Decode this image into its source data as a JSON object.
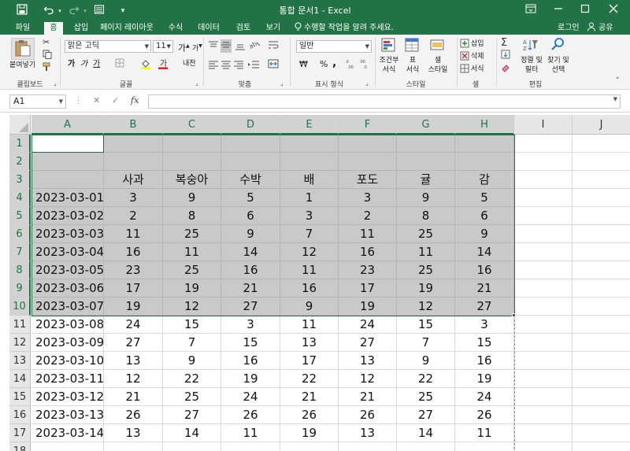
{
  "titlebar": {
    "title": "통합 문서1 - Excel",
    "save_icon": "save-icon",
    "undo_icon": "undo-icon",
    "redo_icon": "redo-icon",
    "form_icon": "form-icon",
    "customize_icon": "customize-icon",
    "ribbon_display_icon": "ribbon-display-icon",
    "minimize_icon": "minimize-icon",
    "restore_icon": "restore-icon",
    "close_icon": "close-icon"
  },
  "tabs": {
    "items": [
      "파일",
      "홈",
      "삽입",
      "페이지 레이아웃",
      "수식",
      "데이터",
      "검토",
      "보기"
    ],
    "active": "홈",
    "tell_me": "수행할 작업을 알려 주세요.",
    "login": "로그인",
    "share": "공유"
  },
  "ribbon": {
    "clipboard": {
      "paste": "붙여넣기",
      "label": "클립보드"
    },
    "font": {
      "name": "맑은 고딕",
      "size": "11",
      "bold": "가",
      "italic": "가",
      "underline": "가",
      "grow": "가",
      "shrink": "가",
      "phonetic": "내천",
      "label": "글꼴"
    },
    "align": {
      "label": "맞춤"
    },
    "number": {
      "format": "일반",
      "currency": "₩",
      "percent": "%",
      "comma": ",",
      "label": "표시 형식"
    },
    "styles": {
      "conditional": "조건부\n서식",
      "table": "표\n서식",
      "cell_style": "셀\n스타일",
      "label": "스타일"
    },
    "cells": {
      "insert": "삽입",
      "delete": "삭제",
      "format": "서식",
      "label": "셀"
    },
    "editing": {
      "sort": "정렬 및\n필터",
      "find": "찾기 및\n선택",
      "label": "편집"
    }
  },
  "formula_bar": {
    "namebox": "A1",
    "cancel": "✕",
    "enter": "✓",
    "fx": "fx",
    "value": ""
  },
  "sheet": {
    "columns": [
      "A",
      "B",
      "C",
      "D",
      "E",
      "F",
      "G",
      "H",
      "I",
      "J"
    ],
    "rows": [
      "1",
      "2",
      "3",
      "4",
      "5",
      "6",
      "7",
      "8",
      "9",
      "10",
      "11",
      "12",
      "13",
      "14",
      "15",
      "16",
      "17",
      "18"
    ],
    "headers": [
      "",
      "사과",
      "복숭아",
      "수박",
      "배",
      "포도",
      "귤",
      "감"
    ],
    "data": [
      [
        "2023-03-01",
        "3",
        "9",
        "5",
        "1",
        "3",
        "9",
        "5"
      ],
      [
        "2023-03-02",
        "2",
        "8",
        "6",
        "3",
        "2",
        "8",
        "6"
      ],
      [
        "2023-03-03",
        "11",
        "25",
        "9",
        "7",
        "11",
        "25",
        "9"
      ],
      [
        "2023-03-04",
        "16",
        "11",
        "14",
        "12",
        "16",
        "11",
        "14"
      ],
      [
        "2023-03-05",
        "23",
        "25",
        "16",
        "11",
        "23",
        "25",
        "16"
      ],
      [
        "2023-03-06",
        "17",
        "19",
        "21",
        "16",
        "17",
        "19",
        "21"
      ],
      [
        "2023-03-07",
        "19",
        "12",
        "27",
        "9",
        "19",
        "12",
        "27"
      ],
      [
        "2023-03-08",
        "24",
        "15",
        "3",
        "11",
        "24",
        "15",
        "3"
      ],
      [
        "2023-03-09",
        "27",
        "7",
        "15",
        "13",
        "27",
        "7",
        "15"
      ],
      [
        "2023-03-10",
        "13",
        "9",
        "16",
        "17",
        "13",
        "9",
        "16"
      ],
      [
        "2023-03-11",
        "12",
        "22",
        "19",
        "22",
        "12",
        "22",
        "19"
      ],
      [
        "2023-03-12",
        "21",
        "25",
        "24",
        "21",
        "21",
        "25",
        "24"
      ],
      [
        "2023-03-13",
        "26",
        "27",
        "26",
        "26",
        "26",
        "27",
        "26"
      ],
      [
        "2023-03-14",
        "13",
        "14",
        "11",
        "19",
        "13",
        "14",
        "11"
      ]
    ],
    "selection": "A1:H10",
    "active_cell": "A1",
    "selection_color": "#217346"
  },
  "colors": {
    "accent": "#217346",
    "highlight": "#c9c9c9"
  }
}
